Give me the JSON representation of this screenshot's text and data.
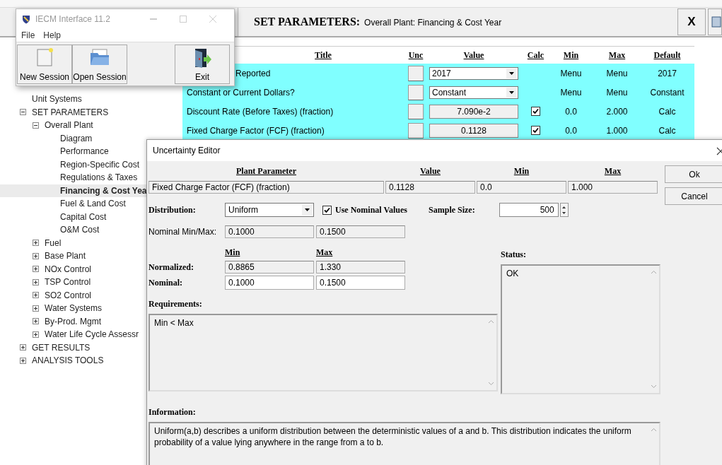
{
  "app_window": {
    "title": "IECM Interface 11.2",
    "menu": [
      "File",
      "Help"
    ],
    "toolbar": [
      {
        "label": "New Session",
        "kind": "new"
      },
      {
        "label": "Open Session",
        "kind": "open"
      },
      {
        "label": "Exit",
        "kind": "exit"
      }
    ]
  },
  "header": {
    "title": "SET PARAMETERS:",
    "subtitle": "Overall Plant: Financing & Cost Year",
    "close": "X"
  },
  "tree": [
    {
      "label": "Unit Systems",
      "selected": false
    },
    {
      "label": "SET PARAMETERS",
      "selected": false,
      "expanded": true,
      "children": [
        {
          "label": "Overall Plant",
          "selected": false,
          "expanded": true,
          "children": [
            {
              "label": "Diagram",
              "selected": false
            },
            {
              "label": "Performance",
              "selected": false
            },
            {
              "label": "Region-Specific Cost",
              "selected": false
            },
            {
              "label": "Regulations & Taxes",
              "selected": false
            },
            {
              "label": "Financing & Cost Yea",
              "selected": true
            },
            {
              "label": "Fuel & Land Cost",
              "selected": false
            },
            {
              "label": "Capital Cost",
              "selected": false
            },
            {
              "label": "O&M Cost",
              "selected": false
            }
          ]
        },
        {
          "label": "Fuel",
          "selected": false,
          "expanded": false
        },
        {
          "label": "Base Plant",
          "selected": false,
          "expanded": false
        },
        {
          "label": "NOx Control",
          "selected": false,
          "expanded": false
        },
        {
          "label": "TSP Control",
          "selected": false,
          "expanded": false
        },
        {
          "label": "SO2 Control",
          "selected": false,
          "expanded": false
        },
        {
          "label": "Water Systems",
          "selected": false,
          "expanded": false
        },
        {
          "label": "By-Prod. Mgmt",
          "selected": false,
          "expanded": false
        },
        {
          "label": "Water Life Cycle Assessr",
          "selected": false,
          "expanded": false
        }
      ]
    },
    {
      "label": "GET RESULTS",
      "selected": false,
      "expanded": false
    },
    {
      "label": "ANALYSIS TOOLS",
      "selected": false,
      "expanded": false
    }
  ],
  "table": {
    "columns": [
      "Title",
      "Unc",
      "Value",
      "Calc",
      "Min",
      "Max",
      "Default"
    ],
    "rows": [
      {
        "title": "Reported",
        "kind": "dropdown",
        "value": "2017",
        "min": "Menu",
        "max": "Menu",
        "default": "2017"
      },
      {
        "title": "Constant or Current Dollars?",
        "kind": "dropdown",
        "value": "Constant",
        "min": "Menu",
        "max": "Menu",
        "default": "Constant"
      },
      {
        "title": "Discount Rate (Before Taxes) (fraction)",
        "kind": "field",
        "value": "7.090e-2",
        "calc_checked": true,
        "min": "0.0",
        "max": "2.000",
        "default": "Calc"
      },
      {
        "title": "Fixed Charge Factor (FCF) (fraction)",
        "kind": "field",
        "value": "0.1128",
        "calc_checked": true,
        "min": "0.0",
        "max": "1.000",
        "default": "Calc"
      }
    ]
  },
  "dialog": {
    "title": "Uncertainty Editor",
    "param_columns": [
      "Plant Parameter",
      "Value",
      "Min",
      "Max"
    ],
    "param_values": [
      "Fixed Charge Factor (FCF) (fraction)",
      "0.1128",
      "0.0",
      "1.000"
    ],
    "buttons": [
      "Ok",
      "Cancel"
    ],
    "distribution": {
      "label": "Distribution:",
      "value": "Uniform"
    },
    "use_nominal": {
      "label": "Use Nominal Values",
      "checked": true
    },
    "sample_size": {
      "label": "Sample Size:",
      "value": "500"
    },
    "nominal_minmax": {
      "label": "Nominal Min/Max:",
      "values": [
        "0.1000",
        "0.1500"
      ]
    },
    "range_columns": [
      "Min",
      "Max"
    ],
    "normalized": {
      "label": "Normalized:",
      "values": [
        "0.8865",
        "1.330"
      ]
    },
    "nominal": {
      "label": "Nominal:",
      "values": [
        "0.1000",
        "0.1500"
      ]
    },
    "status": {
      "label": "Status:",
      "text": "OK"
    },
    "requirements": {
      "label": "Requirements:",
      "text": "Min < Max"
    },
    "information": {
      "label": "Information:",
      "text": "Uniform(a,b) describes a uniform distribution between the deterministic values of a and b. This distribution indicates the uniform probability of a value lying anywhere in the range from a to b."
    }
  }
}
